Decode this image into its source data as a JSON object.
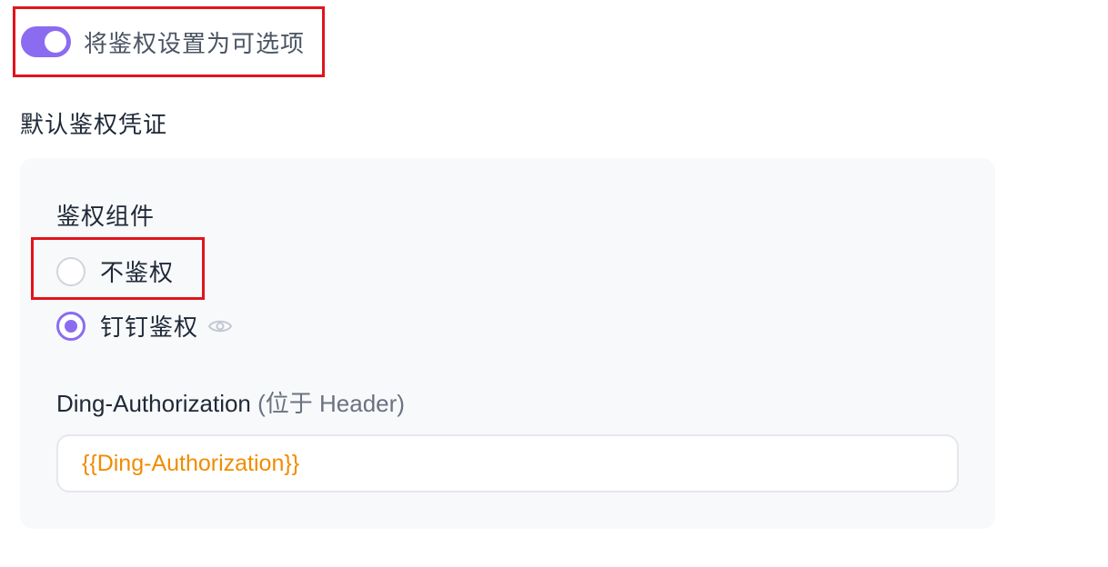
{
  "optional_toggle": {
    "label": "将鉴权设置为可选项",
    "enabled": true,
    "color": "#8b6cf0"
  },
  "section": {
    "title": "默认鉴权凭证"
  },
  "auth_component": {
    "label": "鉴权组件",
    "options": [
      {
        "label": "不鉴权",
        "selected": false
      },
      {
        "label": "钉钉鉴权",
        "selected": true,
        "icon": "eye-icon"
      }
    ]
  },
  "field": {
    "name": "Ding-Authorization",
    "location": "(位于 Header)",
    "value": "{{Ding-Authorization}}",
    "value_color": "#f08c00"
  },
  "colors": {
    "accent": "#8b6cf0",
    "highlight_border": "#e0141c",
    "card_bg": "#f8f9fb"
  }
}
